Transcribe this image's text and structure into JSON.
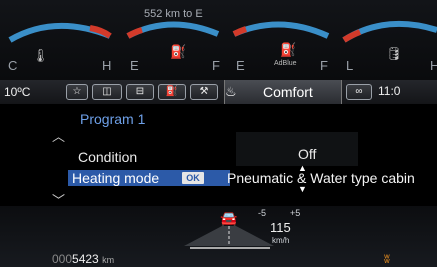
{
  "gauges": {
    "range_text": "552 km to E",
    "temp": {
      "cold": "C",
      "hot": "H"
    },
    "fuel": {
      "empty": "E",
      "full": "F"
    },
    "adblue": {
      "empty": "E",
      "full": "F",
      "label": "AdBlue"
    },
    "oil": {
      "low": "L",
      "high": "H"
    }
  },
  "status": {
    "outside_temp": "10ºC",
    "time": "11:0",
    "active_tab_label": "Comfort"
  },
  "tabs": [
    {
      "icon": "star-icon"
    },
    {
      "icon": "vehicle-assist-icon"
    },
    {
      "icon": "trailer-icon"
    },
    {
      "icon": "fuel-system-icon"
    },
    {
      "icon": "tools-icon"
    },
    {
      "icon": "heating-icon"
    },
    {
      "icon": "link-icon"
    }
  ],
  "menu": {
    "program": "Program 1",
    "condition_label": "Condition",
    "condition_value": "Off",
    "heating_label": "Heating mode",
    "ok_badge": "OK",
    "heating_value": "Pneumatic & Water type cabin"
  },
  "bottom": {
    "odometer_prefix": "000",
    "odometer_value": "5423",
    "odometer_unit": "km",
    "speed_minus": "-5",
    "speed_plus": "+5",
    "speed_value": "115",
    "speed_unit": "km/h"
  },
  "colors": {
    "accent_blue": "#2c5aa8",
    "program_text": "#6ea0e8",
    "warning_orange": "#e08a20",
    "gauge_red": "#d23a2a",
    "gauge_blue": "#3a8fc8"
  }
}
